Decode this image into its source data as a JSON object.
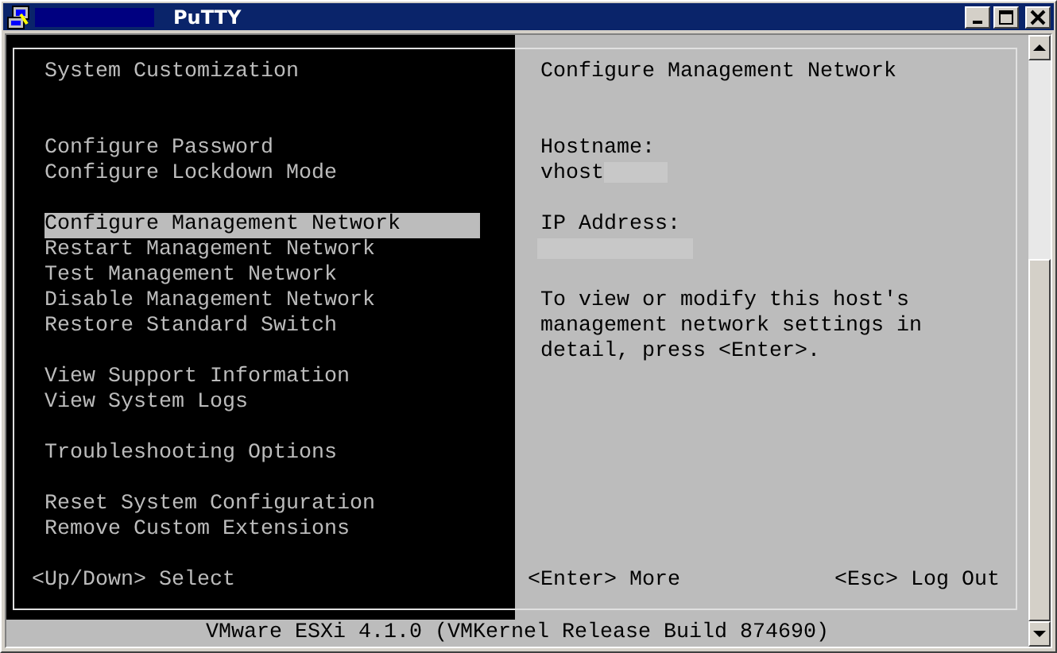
{
  "window": {
    "title": "PuTTY"
  },
  "left_panel": {
    "title": "System Customization",
    "menu_groups": [
      [
        {
          "label": "Configure Password",
          "selected": false
        },
        {
          "label": "Configure Lockdown Mode",
          "selected": false
        }
      ],
      [
        {
          "label": "Configure Management Network",
          "selected": true
        },
        {
          "label": "Restart Management Network",
          "selected": false
        },
        {
          "label": "Test Management Network",
          "selected": false
        },
        {
          "label": "Disable Management Network",
          "selected": false
        },
        {
          "label": "Restore Standard Switch",
          "selected": false
        }
      ],
      [
        {
          "label": "View Support Information",
          "selected": false
        },
        {
          "label": "View System Logs",
          "selected": false
        }
      ],
      [
        {
          "label": "Troubleshooting Options",
          "selected": false
        }
      ],
      [
        {
          "label": "Reset System Configuration",
          "selected": false
        },
        {
          "label": "Remove Custom Extensions",
          "selected": false
        }
      ]
    ],
    "footer": "<Up/Down> Select"
  },
  "right_panel": {
    "title": "Configure Management Network",
    "fields": [
      {
        "label": "Hostname:",
        "value": "vhost"
      },
      {
        "label": "IP Address:"
      }
    ],
    "description": "To view or modify this host's management network settings in detail, press <Enter>.",
    "footer_left": "<Enter> More",
    "footer_right": "<Esc> Log Out"
  },
  "status_line": "VMware ESXi 4.1.0 (VMKernel Release Build 874690)"
}
